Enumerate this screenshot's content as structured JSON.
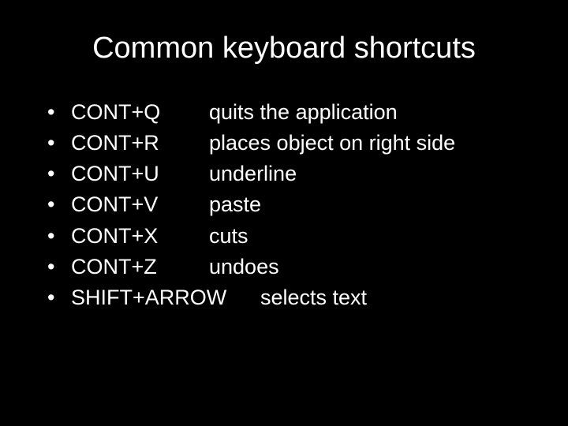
{
  "title": "Common keyboard shortcuts",
  "items": [
    {
      "shortcut": "CONT+Q",
      "description": "quits the application",
      "wide": false
    },
    {
      "shortcut": "CONT+R",
      "description": "places object on right side",
      "wide": false
    },
    {
      "shortcut": "CONT+U",
      "description": "underline",
      "wide": false
    },
    {
      "shortcut": "CONT+V",
      "description": "paste",
      "wide": false
    },
    {
      "shortcut": "CONT+X",
      "description": "cuts",
      "wide": false
    },
    {
      "shortcut": "CONT+Z",
      "description": "undoes",
      "wide": false
    },
    {
      "shortcut": "SHIFT+ARROW",
      "description": "selects text",
      "wide": true
    }
  ]
}
